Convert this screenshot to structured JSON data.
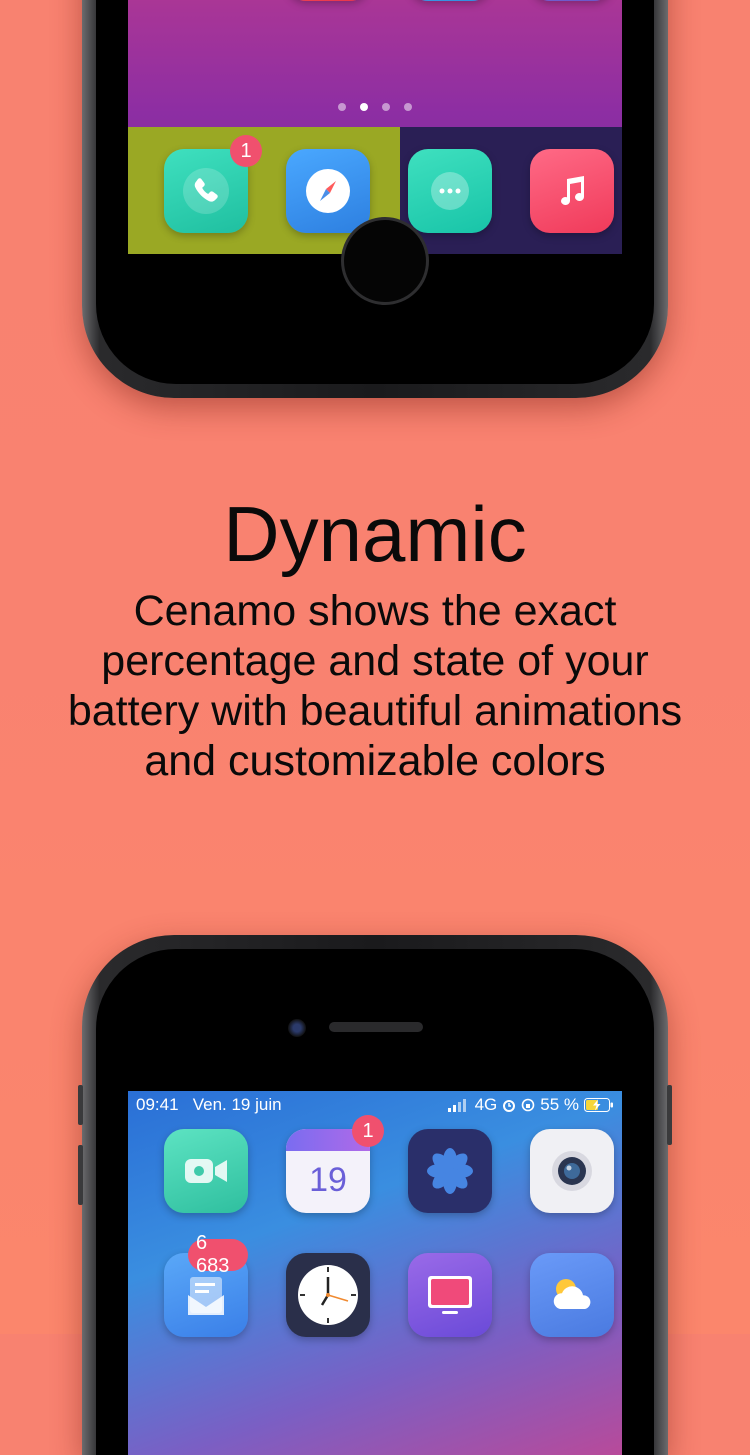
{
  "colors": {
    "background": "#f98270",
    "battery_fill": "#9aa824",
    "badge": "#f0506e"
  },
  "top_phone": {
    "page_dots": {
      "count": 4,
      "active_index": 1
    },
    "dock_badge_phone": "1",
    "battery_level_fraction": 0.55,
    "icons": [
      "youtube-icon",
      "twitter-icon",
      "discord-icon",
      "phone-icon",
      "compass-icon",
      "messages-icon",
      "music-icon"
    ]
  },
  "headline": "Dynamic",
  "subtext": "Cenamo shows the exact percentage and state of your battery with beautiful animations and customizable colors",
  "bottom_phone": {
    "status_bar": {
      "time": "09:41",
      "date": "Ven. 19 juin",
      "network": "4G",
      "battery_percent": "55 %"
    },
    "calendar_day": "19",
    "calendar_badge": "1",
    "mail_badge": "6 683",
    "icons": [
      "facetime-icon",
      "calendar-icon",
      "photos-icon",
      "camera-icon",
      "mail-icon",
      "clock-icon",
      "tv-icon",
      "weather-icon"
    ]
  }
}
